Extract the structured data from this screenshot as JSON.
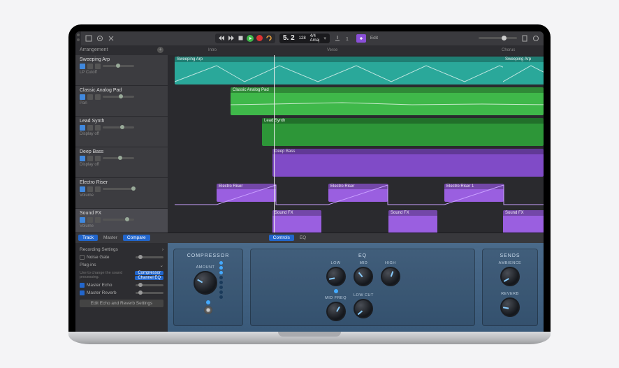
{
  "transport": {
    "position": "5. 2",
    "tempo": "128",
    "sig_top": "4/4",
    "sig_bot": "Amaj"
  },
  "toolbar": {
    "edit_label": "Edit"
  },
  "arrange": {
    "header": "Arrangement",
    "markers": [
      "Intro",
      "Verse",
      "Chorus"
    ]
  },
  "tracks": [
    {
      "name": "Sweeping Arp",
      "sub": "LP Cutoff",
      "color": "teal"
    },
    {
      "name": "Classic Analog Pad",
      "sub": "Pan",
      "color": "green"
    },
    {
      "name": "Lead Synth",
      "sub": "Display off",
      "color": "green"
    },
    {
      "name": "Deep Bass",
      "sub": "Display off",
      "color": "purple"
    },
    {
      "name": "Electro Riser",
      "sub": "Volume",
      "color": "purple"
    },
    {
      "name": "Sound FX",
      "sub": "Volume",
      "color": "purple"
    }
  ],
  "regions": {
    "r0": "Sweeping Arp",
    "r1": "Classic Analog Pad",
    "r2": "Lead Synth",
    "r3": "Deep Bass",
    "r4a": "Electro Riser",
    "r4b": "Electro Riser 1",
    "r5": "Sound FX"
  },
  "smart": {
    "tabs": {
      "track": "Track",
      "master": "Master",
      "compare": "Compare",
      "controls": "Controls",
      "eq": "EQ"
    },
    "inspector": {
      "rec_settings": "Recording Settings",
      "noise_gate": "Noise Gate",
      "plugins": "Plug-ins",
      "plugins_hint": "Use to change the sound processing.",
      "compressor": "Compressor",
      "channel_eq": "Channel EQ",
      "master_echo": "Master Echo",
      "master_reverb": "Master Reverb",
      "edit_btn": "Edit Echo and Reverb Settings"
    },
    "sections": {
      "compressor": "COMPRESSOR",
      "eq": "EQ",
      "sends": "SENDS"
    },
    "knobs": {
      "amount": "AMOUNT",
      "low": "LOW",
      "mid": "MID",
      "high": "HIGH",
      "mid_freq": "MID FREQ",
      "low_cut": "LOW CUT",
      "ambience": "AMBIENCE",
      "reverb": "REVERB"
    }
  }
}
